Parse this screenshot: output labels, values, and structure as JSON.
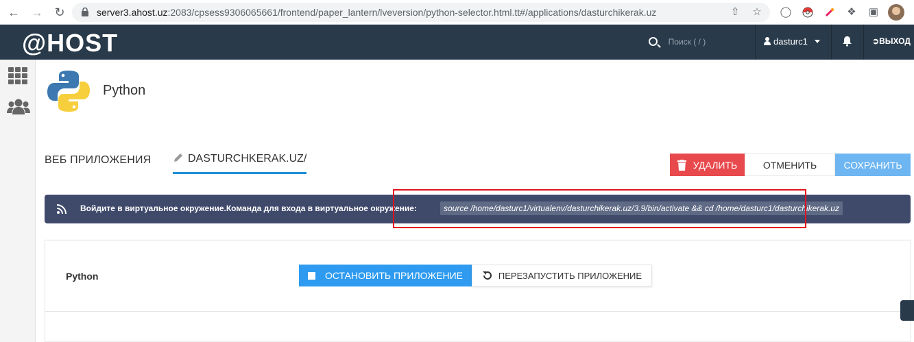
{
  "browser": {
    "url_host": "server3.ahost.uz",
    "url_rest": ":2083/cpsess9306065661/frontend/paper_lantern/lveversion/python-selector.html.tt#/applications/dasturchikerak.uz"
  },
  "topbar": {
    "logo": "@HOST",
    "search_placeholder": "Поиск ( / )",
    "username": "dasturc1",
    "logout_label": "ВЫХОД"
  },
  "page": {
    "title": "Python"
  },
  "tabs": {
    "web_apps": "ВЕБ ПРИЛОЖЕНИЯ",
    "current_app": "DASTURCHKERAK.UZ/"
  },
  "actions": {
    "delete_label": "УДАЛИТЬ",
    "cancel_label": "ОТМЕНИТЬ",
    "save_label": "СОХРАНИТЬ"
  },
  "banner": {
    "message": "Войдите в виртуальное окружение.Команда для входа в виртуальное окружение:",
    "command": "source /home/dasturc1/virtualenv/dasturchikerak.uz/3.9/bin/activate && cd /home/dasturc1/dasturchikerak.uz"
  },
  "app_card": {
    "label": "Python",
    "stop_label": "ОСТАНОВИТЬ ПРИЛОЖЕНИЕ",
    "restart_label": "ПЕРЕЗАПУСТИТЬ ПРИЛОЖЕНИЕ"
  },
  "colors": {
    "topbar": "#293a4a",
    "delete": "#e8494c",
    "save": "#6eb6f2",
    "stop": "#2e9bf0",
    "banner": "#3f4a6b",
    "highlight": "#e3121c"
  }
}
